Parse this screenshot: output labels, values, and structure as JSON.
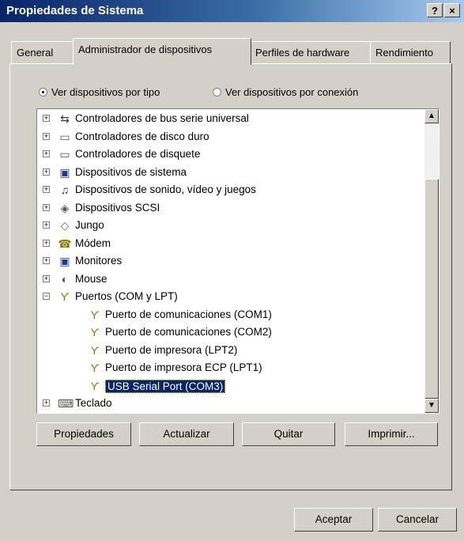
{
  "window": {
    "title": "Propiedades de Sistema",
    "help_button": "?",
    "close_button": "×"
  },
  "tabs": [
    {
      "label": "General"
    },
    {
      "label": "Administrador de dispositivos",
      "active": true
    },
    {
      "label": "Perfiles de hardware"
    },
    {
      "label": "Rendimiento"
    }
  ],
  "view_options": {
    "by_type": "Ver dispositivos por tipo",
    "by_connection": "Ver dispositivos por conexión",
    "selected": "by_type"
  },
  "tree": {
    "items": [
      {
        "label": "Controladores de bus serie universal",
        "icon": "usb-icon",
        "expander": "+"
      },
      {
        "label": "Controladores de disco duro",
        "icon": "disk-icon",
        "expander": "+"
      },
      {
        "label": "Controladores de disquete",
        "icon": "floppy-icon",
        "expander": "+"
      },
      {
        "label": "Dispositivos de sistema",
        "icon": "computer-icon",
        "expander": "+"
      },
      {
        "label": "Dispositivos de sonido, vídeo y juegos",
        "icon": "sound-icon",
        "expander": "+"
      },
      {
        "label": "Dispositivos SCSI",
        "icon": "scsi-icon",
        "expander": "+"
      },
      {
        "label": "Jungo",
        "icon": "jungo-icon",
        "expander": "+"
      },
      {
        "label": "Módem",
        "icon": "modem-icon",
        "expander": "+"
      },
      {
        "label": "Monitores",
        "icon": "monitor-icon",
        "expander": "+"
      },
      {
        "label": "Mouse",
        "icon": "mouse-icon",
        "expander": "+"
      },
      {
        "label": "Puertos (COM y LPT)",
        "icon": "port-icon",
        "expander": "−"
      },
      {
        "label": "Puerto de comunicaciones (COM1)",
        "icon": "port-icon",
        "child": true
      },
      {
        "label": "Puerto de comunicaciones (COM2)",
        "icon": "port-icon",
        "child": true
      },
      {
        "label": "Puerto de impresora (LPT2)",
        "icon": "port-icon",
        "child": true
      },
      {
        "label": "Puerto de impresora ECP (LPT1)",
        "icon": "port-icon",
        "child": true
      },
      {
        "label": "USB Serial Port (COM3)",
        "icon": "port-icon",
        "child": true,
        "selected": true
      },
      {
        "label": "Teclado",
        "icon": "keyboard-icon",
        "expander": "+"
      }
    ]
  },
  "scrollbar": {
    "up": "▲",
    "down": "▼"
  },
  "buttons": {
    "properties": "Propiedades",
    "refresh": "Actualizar",
    "remove": "Quitar",
    "print": "Imprimir...",
    "accept": "Aceptar",
    "cancel": "Cancelar"
  },
  "colors": {
    "title_start": "#0a246a",
    "title_end": "#a6caf0",
    "selection": "#0a246a",
    "face": "#d4d0c8"
  }
}
